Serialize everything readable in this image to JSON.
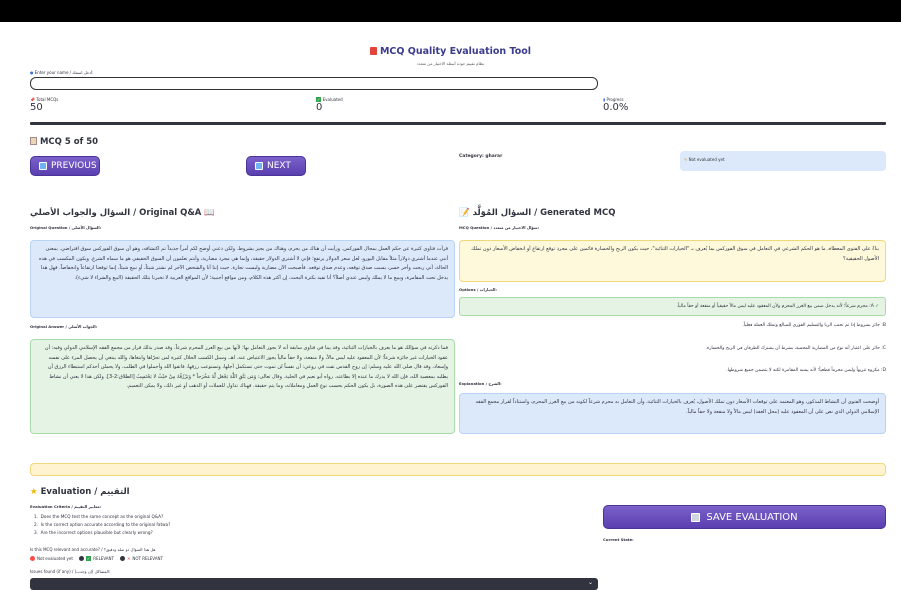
{
  "header": {
    "title": "MCQ Quality Evaluation Tool",
    "subtitle": "نظام تقييم جودة أسئلة الاختيار من متعدد",
    "name_label": "Enter your name / أدخل اسمك:",
    "name_value": ""
  },
  "metrics": {
    "total_label": "Total MCQs",
    "total_value": "50",
    "evaluated_label": "Evaluated",
    "evaluated_value": "0",
    "progress_label": "Progress",
    "progress_value": "0.0%"
  },
  "nav": {
    "counter": "MCQ 5 of 50",
    "prev_label": "PREVIOUS",
    "next_label": "NEXT",
    "category": "Category: gharar",
    "status": "Not evaluated yet"
  },
  "original": {
    "heading": "السؤال والجواب الأصلي / Original Q&A",
    "question_label": "Original Question / السؤال الأصلي:",
    "question_text": "قرأت فتاوى كثيرة عن حكم العمل بمجال الفوركس. ورأيت أن هناك من يحرم، وهناك من يجيز بشروط. ولكن دعني أوضح لكم أمراً جديداً تم اكتشافه، وهو أن سوق الفوركس سوق افتراضي. بمعنى أنني عندما أشتري دولاراً مثلاً مقابل اليورو، لعل سعر الدولار يرتفع؛ فإني لا أشتري الدولار حقيقة، وإنما هي مجرد مضاربة، وأنتم تعلمون أن السوق الحقيقي هو ما سماه الشرع. ويكون المكسب في هذه الحالة، أني ربحت وأخر خسر، بسبب صدق توقعه، وعدم صدق توقعه. فأصبحت الآن مضاربة وليست تجارة. حيث إننا أنا والشخص الآخر لم نشتر شيئاً، أو نبيع شيئاً، إنما توقعنا ارتفاعاً وانخفاضاً. فهل هذا يدخل تحت المقامرة، ويبيع ما لا يملك وليس عندي أصلاً؟ أنا تفيد بكثرة البحث، إن أكثر هذه الكلام، ومن مواقع أجنبية؛ لأن المواقع العربية لا تخبرنا بتلك الحقيقة (البيع والشراء لا شيء).",
    "answer_label": "Original Answer / الجواب الأصلي:",
    "answer_text": "فما ذكرته في سؤالك هو ما يعرف بالخيارات الثنائية، وقد بينا في فتاوى سابقة أنه لا يجوز التعامل بها؛ لأنها من بيع الغرر المحرم شرعاً. وقد صدر بذلك قرار من مجمع الفقه الإسلامي الدولي وفيه: أن عقود الخيارات غير جائزة شرعاً؛ لأن المعقود عليه ليس مالاً، ولا منفعة، ولا حقاً مالياً يجوز الاعتياض عنه. اهـ. وسبل الكسب الحلال كثيرة لمن تحرّاها وابتغاها، والله يبتغي أن يحصل المرء على نفسه وإسعاد، وقد قال صلى الله عليه وسلم: إن روح القدس نفث في روعي: أن نفساً لن تموت حتى تستكمل أجلها، وتستوعب رزقها، فاتقوا الله وأجملوا في الطلب، ولا يحملن أحدكم استبطاء الرزق أن يطلبه بمعصية الله، فإن الله لا يدرك ما عنده إلا بطاعته. رواه أبو نعيم في الحلية. وقال تعالى: وَمَن يَتَّقِ اللَّهَ يَجْعَل لَّهُ مَخْرَجاً * وَيَرْزُقْهُ مِنْ حَيْثُ لا يَحْتَسِبُ [الطلاق:2-3]. ولكن هذا لا يعني أن نشاط الفوركس يقتصر على هذه الصورة، بل يكون الحكم بحسب نوع العمل ومعاملاته، وما يتم حقيقة. فهناك تداول للعملات أو الذهب أو غير ذلك، ولا يمكن التعميم."
  },
  "generated": {
    "heading": "السؤال المُوَلَّد / Generated MCQ",
    "question_label": "MCQ Question / سؤال الاختيار من متعدد:",
    "question_text": "بناءً على الفتوى المعطاة، ما هو الحكم الشرعي في التعامل في سوق الفوركس بما يُعرف بـ \"الخيارات الثنائية\"، حيث يكون الربح والخسارة قائمين على مجرد توقع ارتفاع أو انخفاض الأسعار دون تملك الأصول الحقيقية؟",
    "options_label": "Options / الخيارات:",
    "options": [
      {
        "text": "A: محرم شرعاً؛ لأنه يدخل ضمن بيع الغرر المحرم ولأن المعقود عليه ليس مالاً حقيقياً أو منفعة أو حقاً مالياً.",
        "correct": true
      },
      {
        "text": "B: جائز بشروط إذا تم تجنب الربا والتسليم الفوري للمبالغ وتملك العملة فعلياً.",
        "correct": false
      },
      {
        "text": "C: جائز على اعتبار أنه نوع من المضاربة المحمية، بشرط أن يشترك الطرفان في الربح والخسارة.",
        "correct": false
      },
      {
        "text": "D: مكروه تنزيهاً وليس محرماً قطعياً؛ لأنه يشبه المقامرة لكنه لا يتضمن جميع شروطها.",
        "correct": false
      }
    ],
    "explanation_label": "Explanation / الشرح:",
    "explanation_text": "أوضحت الفتوى أن النشاط المذكور، وهو المعتمد على توقعات الأسعار دون تملك الأصول، يُعرف بالخيارات الثنائية، وأن التعامل به محرم شرعاً لكونه من بيع الغرر المحرم، واستناداً لقرار مجمع الفقه الإسلامي الدولي الذي نص على أن المعقود عليه (محل العقد) ليس مالاً ولا منفعة ولا حقاً مالياً."
  },
  "evaluation": {
    "heading": "Evaluation / التقييم",
    "criteria_label": "Evaluation Criteria / معايير التقييم:",
    "criteria": [
      "Does the MCQ test the same concept as the original Q&A?",
      "Is the correct option accurate according to the original fatwa?",
      "Are the incorrect options plausible but clearly wrong?"
    ],
    "relevance_label": "Is this MCQ relevant and accurate? / هل هذا السؤال ذو صلة ودقيق؟",
    "radio_options": [
      "Not evaluated yet",
      "RELEVANT",
      "NOT RELEVANT"
    ],
    "issues_label": "Issues found (if any) / المشاكل (إن وجدت):",
    "save_label": "SAVE EVALUATION",
    "current_state_label": "Current State:"
  },
  "colors": {
    "accent": "#5a3fb0",
    "blue_box": "#dce9fb",
    "green_box": "#e4f3e4",
    "yellow_box": "#fff9db"
  }
}
